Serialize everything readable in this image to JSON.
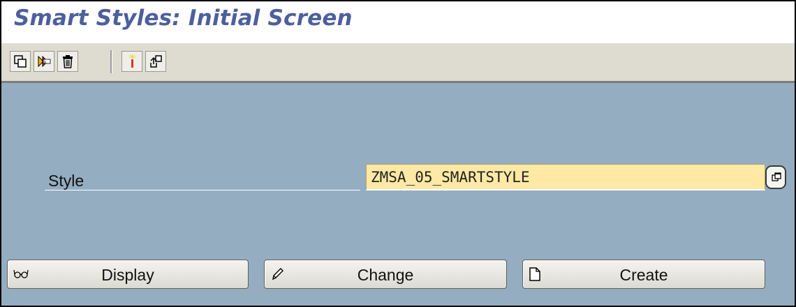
{
  "title": "Smart Styles: Initial Screen",
  "toolbar": {
    "icons": [
      "copy-icon",
      "rename-icon",
      "delete-icon",
      "new-icon",
      "transport-icon"
    ]
  },
  "form": {
    "style_label": "Style",
    "style_value": "ZMSA_05_SMARTSTYLE",
    "input_color": "#ffe9a4"
  },
  "buttons": {
    "display_label": "Display",
    "change_label": "Change",
    "create_label": "Create"
  },
  "colors": {
    "title": "#4d5f9c",
    "content_bg": "#94adc1",
    "toolbar_bg": "#dedcd1"
  }
}
